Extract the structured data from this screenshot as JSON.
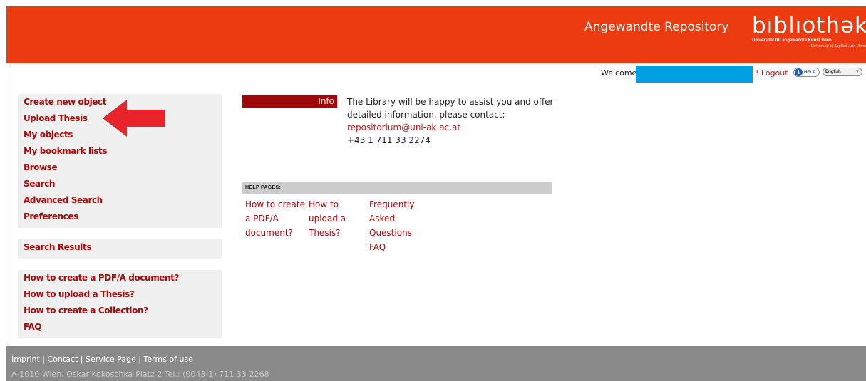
{
  "header": {
    "repo_title": "Angewandte Repository",
    "logo_word": "bıblıothək",
    "logo_sub1": "Universität für angewandte Kunst Wien",
    "logo_sub2": "University of Applied Arts Vienna",
    "bg_color": "#ec3b10"
  },
  "userbar": {
    "welcome": "Welcome,",
    "logout": "! Logout",
    "help_label": "HELP",
    "language": "English"
  },
  "sidebar": {
    "group1": [
      "Create new object",
      "Upload Thesis",
      "My objects",
      "My bookmark lists",
      "Browse",
      "Search",
      "Advanced Search",
      "Preferences"
    ],
    "group2": [
      "Search Results"
    ],
    "group3": [
      "How to create a PDF/A document?",
      "How to upload a Thesis?",
      "How to create a Collection?",
      "FAQ"
    ]
  },
  "info": {
    "tab_label": "Info",
    "text": "The Library will be happy to assist you and offer detailed information, please contact:",
    "email": "repositorium@uni-ak.ac.at",
    "phone": "+43 1 711 33 2274"
  },
  "help_pages": {
    "heading": "HELP PAGES:",
    "links": [
      "How to create a PDF/A document?",
      "How to upload a Thesis?",
      "Frequently Asked Questions FAQ"
    ]
  },
  "footer": {
    "links": "Imprint | Contact | Service Page | Terms of use",
    "address": "A-1010 Wien, Oskar Kokoschka-Platz 2 Tel.: (0043-1) 711 33-2268"
  },
  "annotation": {
    "arrow_color": "#e8242a"
  }
}
